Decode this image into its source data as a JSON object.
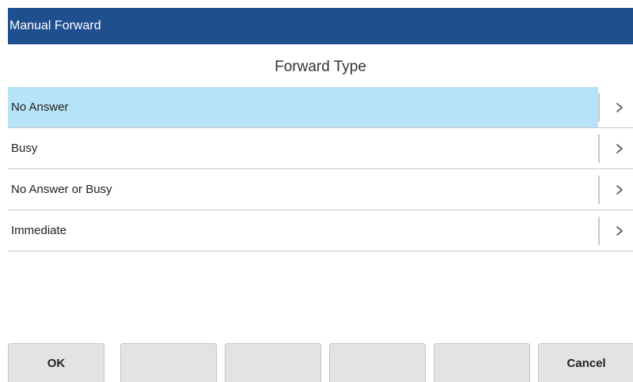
{
  "window": {
    "title": "Manual Forward"
  },
  "screen": {
    "heading": "Forward Type"
  },
  "menu": {
    "selected_index": 0,
    "items": [
      {
        "label": "No Answer",
        "chevron_icon": "chevron-right-icon"
      },
      {
        "label": "Busy",
        "chevron_icon": "chevron-right-icon"
      },
      {
        "label": "No Answer or Busy",
        "chevron_icon": "chevron-right-icon"
      },
      {
        "label": "Immediate",
        "chevron_icon": "chevron-right-icon"
      }
    ]
  },
  "softkeys": [
    {
      "label": "OK"
    },
    {
      "label": ""
    },
    {
      "label": ""
    },
    {
      "label": ""
    },
    {
      "label": ""
    },
    {
      "label": "Cancel"
    }
  ],
  "colors": {
    "titlebar_bg": "#1f4f8f",
    "titlebar_text": "#ffffff",
    "selected_row_bg": "#b6e3f7",
    "divider": "#c9c9c9",
    "softkey_bg": "#e3e3e3"
  }
}
